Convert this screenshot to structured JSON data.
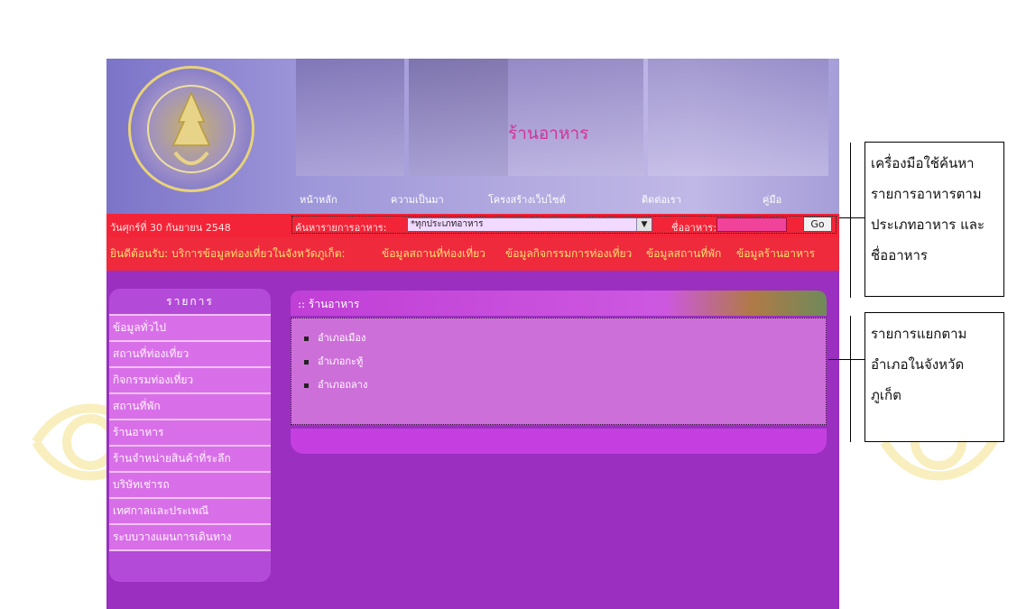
{
  "site": {
    "banner_title": "ร้านอาหาร",
    "nav": [
      "หน้าหลัก",
      "ความเป็นมา",
      "โครงสร้างเว็บไซต์",
      "ติดต่อเรา",
      "คู่มือ"
    ],
    "date": "วันศุกร์ที่ 30 กันยายน 2548"
  },
  "search": {
    "label": "ค้นหารายการอาหาร:",
    "type_value": "*ทุกประเภทอาหาร",
    "name_label": "ชื่ออาหาร:",
    "name_value": "",
    "go_label": "Go"
  },
  "services": {
    "intro": "ยินดีต้อนรับ: บริการข้อมูลท่องเที่ยวในจังหวัดภูเก็ต:",
    "links": [
      "ข้อมูลสถานที่ท่องเที่ยว",
      "ข้อมูลกิจกรรมการท่องเที่ยว",
      "ข้อมูลสถานที่พัก",
      "ข้อมูลร้านอาหาร"
    ]
  },
  "sidebar": {
    "title": "รายการ",
    "items": [
      "ข้อมูลทั่วไป",
      "สถานที่ท่องเที่ยว",
      "กิจกรรมท่องเที่ยว",
      "สถานที่พัก",
      "ร้านอาหาร",
      "ร้านจำหน่ายสินค้าที่ระลึก",
      "บริษัทเช่ารถ",
      "เทศกาลและประเพณี",
      "ระบบวางแผนการเดินทาง"
    ]
  },
  "content": {
    "title": ":: ร้านอาหาร",
    "districts": [
      "อำเภอเมือง",
      "อำเภอกะทู้",
      "อำเภอถลาง"
    ]
  },
  "callouts": [
    {
      "lines": [
        "เครื่องมือใช้ค้นหา",
        "รายการอาหารตาม",
        "ประเภทอาหาร และ",
        "ชื่ออาหาร"
      ]
    },
    {
      "lines": [
        "รายการแยกตาม",
        "อำเภอในจังหวัด",
        "ภูเก็ต"
      ]
    }
  ]
}
